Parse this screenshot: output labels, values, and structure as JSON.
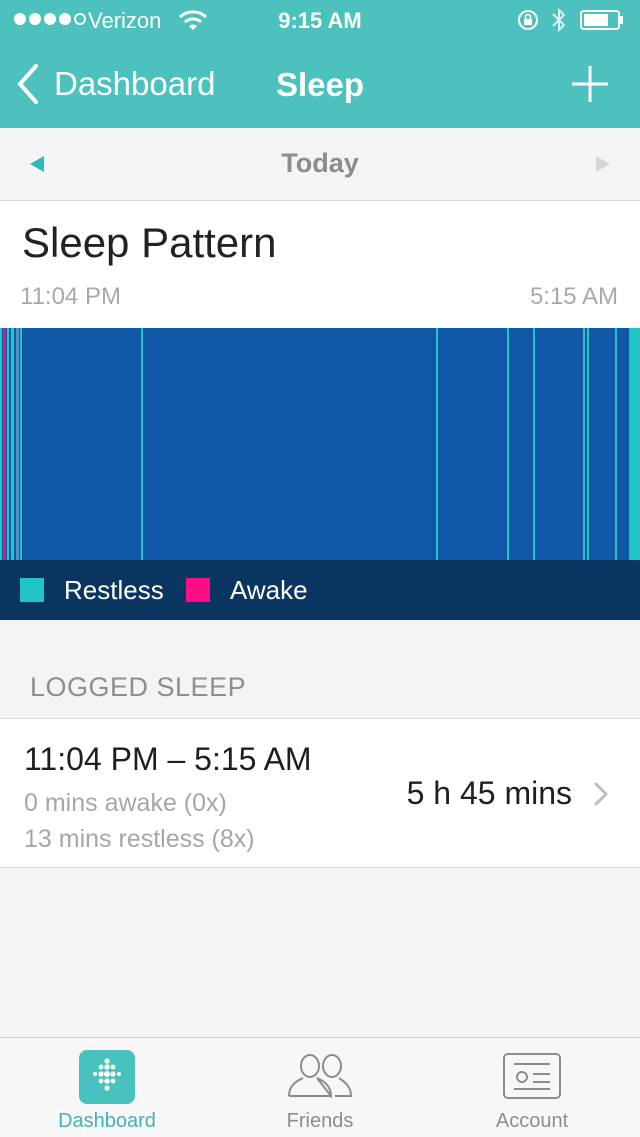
{
  "status_bar": {
    "carrier": "Verizon",
    "time": "9:15 AM",
    "signal_bars_filled": 4,
    "signal_bars_total": 5,
    "icons": [
      "wifi-icon",
      "rotation-lock-icon",
      "bluetooth-icon",
      "battery-icon"
    ]
  },
  "nav": {
    "back_label": "Dashboard",
    "title": "Sleep",
    "action_icon": "plus-icon"
  },
  "date_nav": {
    "label": "Today",
    "prev_icon": "triangle-left-icon",
    "next_icon": "triangle-right-icon"
  },
  "sleep_pattern": {
    "title": "Sleep Pattern",
    "start_time": "11:04 PM",
    "end_time": "5:15 AM",
    "colors": {
      "asleep": "#1057a7",
      "restless": "#20c5c6",
      "awake": "#ff0c87"
    }
  },
  "legend": {
    "restless": "Restless",
    "awake": "Awake"
  },
  "logged_sleep": {
    "header": "LOGGED SLEEP",
    "entries": [
      {
        "range": "11:04 PM – 5:15 AM",
        "awake": "0 mins awake (0x)",
        "restless": "13 mins restless (8x)",
        "duration": "5 h 45 mins"
      }
    ]
  },
  "tabs": [
    {
      "label": "Dashboard",
      "icon": "fitbit-dots-icon",
      "active": true
    },
    {
      "label": "Friends",
      "icon": "friends-icon",
      "active": false
    },
    {
      "label": "Account",
      "icon": "account-card-icon",
      "active": false
    }
  ],
  "colors": {
    "accent": "#4cc1be",
    "legend_bg": "#0a3560"
  }
}
